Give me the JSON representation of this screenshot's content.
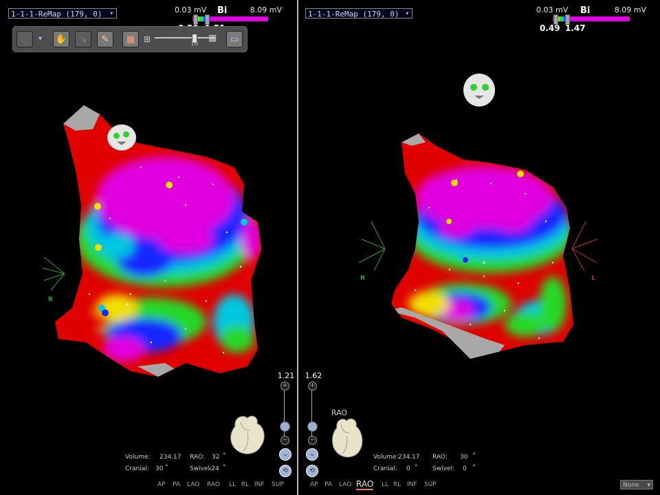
{
  "left_view": {
    "map_name": "1-1-1-ReMap (179, 0)",
    "scale": {
      "min": "0.03 mV",
      "mode": "Bi",
      "max": "8.09 mV",
      "lower_value": "0.50",
      "upper_value": "1.51"
    },
    "toolbar": {
      "slider_value": "16"
    },
    "zoom_value": "1.21",
    "axis_label": "R",
    "info": {
      "volume_label": "Volume:",
      "volume_value": "234.17",
      "rao_label": "RAO:",
      "rao_value": "32",
      "rao_unit": "°",
      "cranial_label": "Cranial:",
      "cranial_value": "30",
      "cranial_unit": "°",
      "swivel_label": "Swivel:",
      "swivel_value": "-24",
      "swivel_unit": "°"
    },
    "views": [
      "AP",
      "PA",
      "LAO",
      "RAO",
      "LL",
      "RL",
      "INF",
      "SUP"
    ]
  },
  "right_view": {
    "map_name": "1-1-1-ReMap (179, 0)",
    "scale": {
      "min": "0.03 mV",
      "mode": "Bi",
      "max": "8.09 mV",
      "lower_value": "0.49",
      "upper_value": "1.47"
    },
    "zoom_value": "1.62",
    "view_tag": "RAO",
    "axis_label_r": "R",
    "axis_label_l": "L",
    "info": {
      "volume_label": "Volume:",
      "volume_value": "234.17",
      "rao_label": "RAO:",
      "rao_value": "30",
      "rao_unit": "°",
      "cranial_label": "Cranial:",
      "cranial_value": "0",
      "cranial_unit": "°",
      "swivel_label": "Swivel:",
      "swivel_value": "0",
      "swivel_unit": "°"
    },
    "views": [
      "AP",
      "PA",
      "LAO",
      "RAO",
      "LL",
      "RL",
      "INF",
      "SUP"
    ],
    "active_view": "RAO",
    "overlay_select": "None"
  },
  "colors": {
    "red": "#e00000",
    "magenta": "#e000e0",
    "blue": "#1428ff",
    "cyan": "#00c8e0",
    "green": "#28d828",
    "yellow": "#f0e000",
    "gray": "#a8a8a8"
  },
  "icons": [
    "dropdown-chevron-icon",
    "rotate-tool-icon",
    "pan-tool-icon",
    "erase-tool-icon",
    "grid-tool-icon",
    "window-tool-icon",
    "zoom-in-icon",
    "zoom-out-icon",
    "head-orientation-icon",
    "heart-orientation-icon"
  ]
}
